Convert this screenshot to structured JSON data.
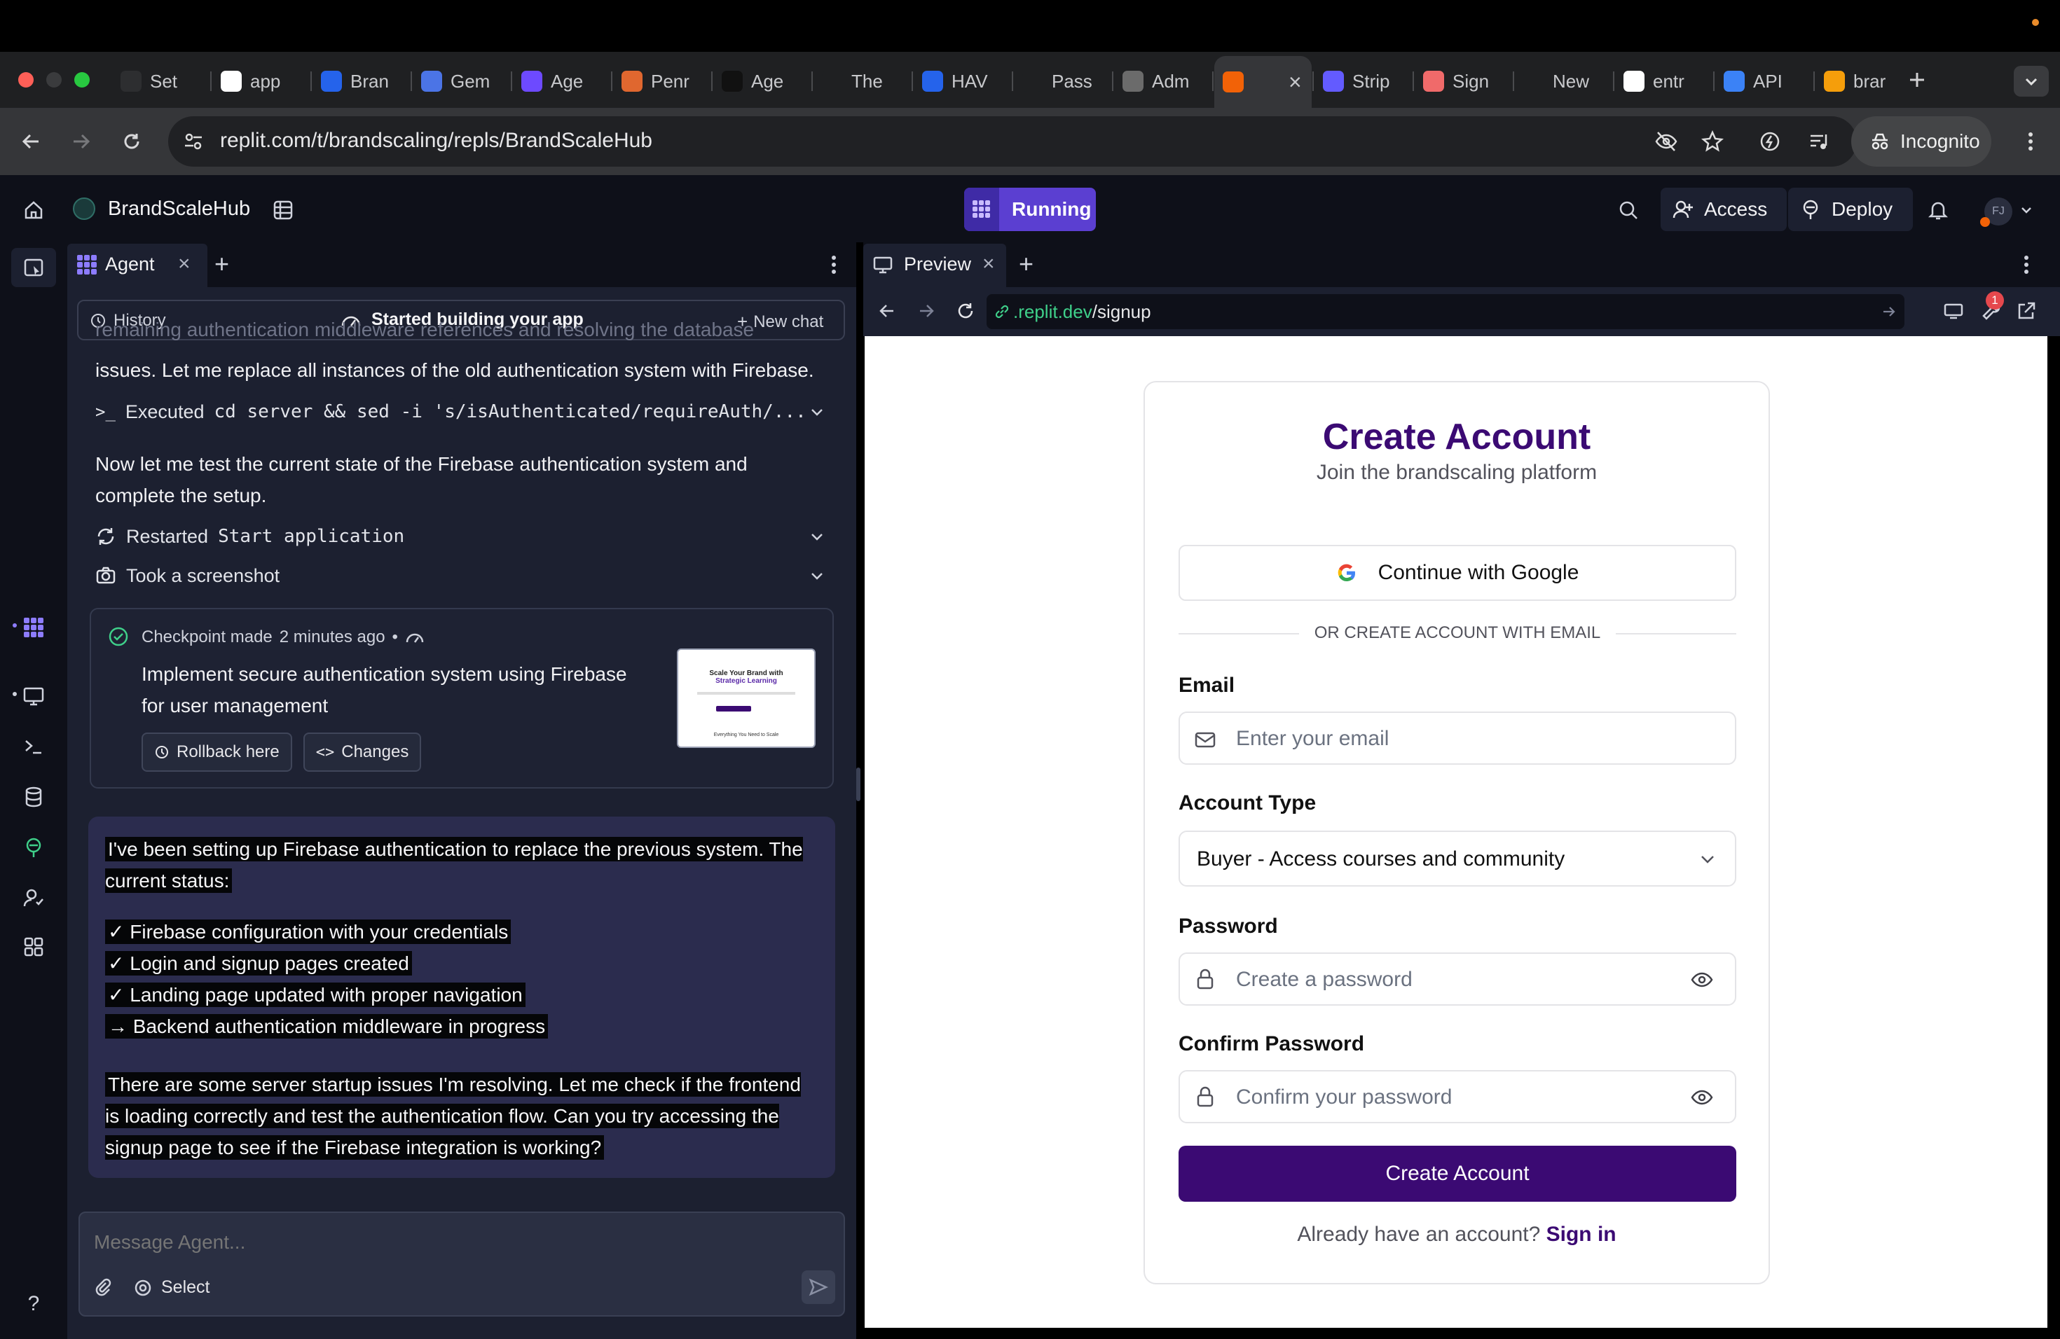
{
  "browser": {
    "tabs": [
      {
        "label": "Set",
        "icon": "openai-icon",
        "color": "#2d2e30"
      },
      {
        "label": "app",
        "icon": "gmail-icon",
        "color": "#ffffff"
      },
      {
        "label": "Bran",
        "icon": "dropbox-icon",
        "color": "#2563eb"
      },
      {
        "label": "Gem",
        "icon": "gemini-icon",
        "color": "#4b74e6"
      },
      {
        "label": "Age",
        "icon": "agent-icon",
        "color": "#6d4aff"
      },
      {
        "label": "Penr",
        "icon": "penrose-icon",
        "color": "#e0672f"
      },
      {
        "label": "Age",
        "icon": "vercel-icon",
        "color": "#111111"
      },
      {
        "label": "The",
        "icon": "blank-icon",
        "color": "#1f2022"
      },
      {
        "label": "HAV",
        "icon": "dropbox-icon",
        "color": "#2563eb"
      },
      {
        "label": "Pass",
        "icon": "upwork-icon",
        "color": "#1f2022"
      },
      {
        "label": "Adm",
        "icon": "globe-icon",
        "color": "#6b6b6b"
      },
      {
        "label": "",
        "icon": "replit-icon",
        "color": "#f26207"
      },
      {
        "label": "Strip",
        "icon": "stripe-icon",
        "color": "#635bff"
      },
      {
        "label": "Sign",
        "icon": "asana-icon",
        "color": "#f06a6a"
      },
      {
        "label": "New",
        "icon": "incognito-icon",
        "color": "#1f2022"
      },
      {
        "label": "entr",
        "icon": "google-icon",
        "color": "#ffffff"
      },
      {
        "label": "API",
        "icon": "openai-icon",
        "color": "#3b82f6"
      },
      {
        "label": "brar",
        "icon": "firebase-icon",
        "color": "#f59e0b"
      }
    ],
    "url": "replit.com/t/brandscaling/repls/BrandScaleHub",
    "incognito_label": "Incognito"
  },
  "app": {
    "project_name": "BrandScaleHub",
    "running_label": "Running",
    "access_label": "Access",
    "deploy_label": "Deploy",
    "avatar_initials": "FJ"
  },
  "agent": {
    "tab_label": "Agent",
    "history_label": "History",
    "status_label": "Started building your app",
    "new_chat_label": "New chat",
    "faded_text": "remaining authentication middleware references and resolving the database",
    "line1": "issues. Let me replace all instances of the old authentication system with Firebase.",
    "executed_prefix": "Executed",
    "executed_cmd": "cd server && sed -i 's/isAuthenticated/requireAuth/...",
    "test_msg": "Now let me test the current state of the Firebase authentication system and complete the setup.",
    "restarted_prefix": "Restarted",
    "restarted_target": "Start application",
    "screenshot_label": "Took a screenshot",
    "checkpoint": {
      "label": "Checkpoint made",
      "time": "2 minutes ago",
      "sep": "•",
      "description": "Implement secure authentication system using Firebase for user management",
      "rollback_label": "Rollback here",
      "changes_label": "Changes",
      "thumb_title": "Scale Your Brand with",
      "thumb_title2": "Strategic Learning",
      "thumb_footer": "Everything You Need to Scale"
    },
    "status_msg": {
      "intro": "I've been setting up Firebase authentication to replace the previous system. The current status:",
      "items": [
        "✓ Firebase configuration with your credentials",
        "✓ Login and signup pages created",
        "✓ Landing page updated with proper navigation",
        "→ Backend authentication middleware in progress"
      ],
      "outro": "There are some server startup issues I'm resolving. Let me check if the frontend is loading correctly and test the authentication flow. Can you try accessing the signup page to see if the Firebase integration is working?"
    },
    "input_placeholder": "Message Agent...",
    "select_label": "Select"
  },
  "preview": {
    "tab_label": "Preview",
    "url_domain": ".replit.dev",
    "url_path": "/signup",
    "badge_count": "1"
  },
  "signup": {
    "title": "Create Account",
    "subtitle": "Join the brandscaling platform",
    "google_label": "Continue with Google",
    "divider": "OR CREATE ACCOUNT WITH EMAIL",
    "email_label": "Email",
    "email_placeholder": "Enter your email",
    "account_type_label": "Account Type",
    "account_type_value": "Buyer - Access courses and community",
    "password_label": "Password",
    "password_placeholder": "Create a password",
    "confirm_label": "Confirm Password",
    "confirm_placeholder": "Confirm your password",
    "submit_label": "Create Account",
    "signin_prompt": "Already have an account?",
    "signin_link": "Sign in",
    "brand_color": "#3b0a73"
  },
  "colors": {
    "running_bg": "#5b3fd1",
    "panel_bg": "#1c2030",
    "message_bg": "#2b2c4e"
  }
}
